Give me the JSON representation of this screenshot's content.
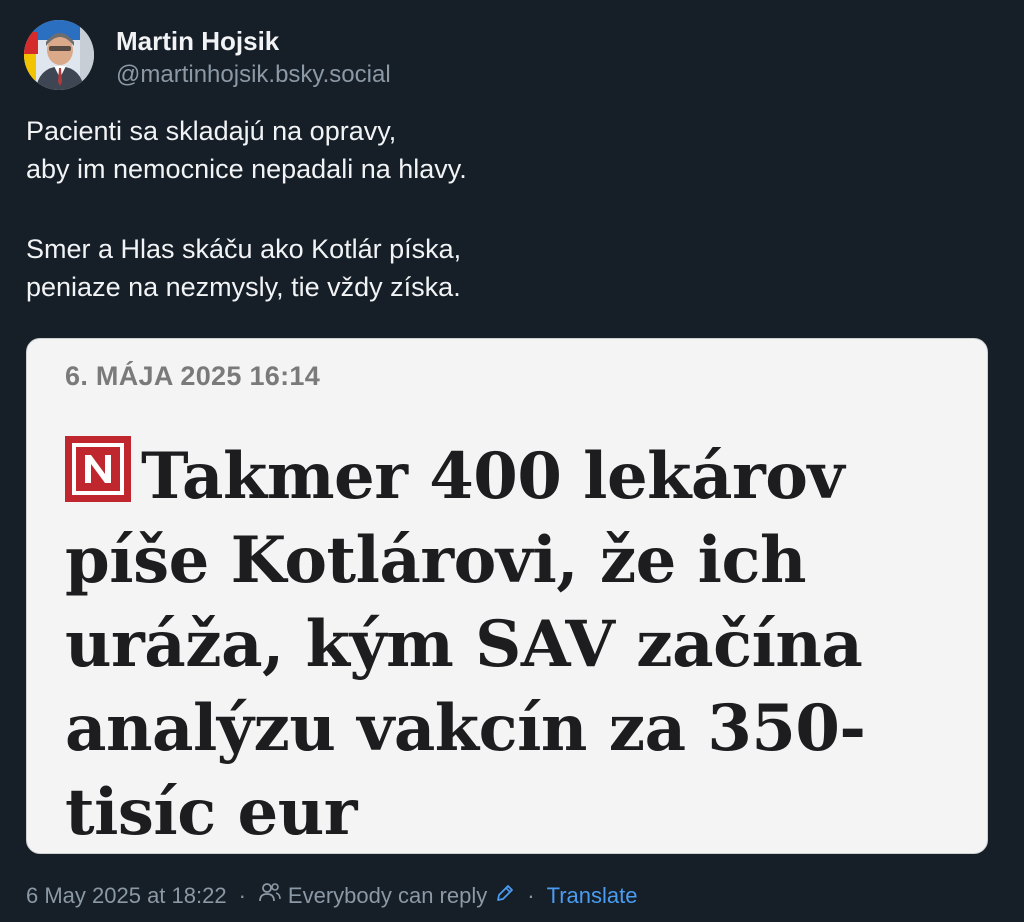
{
  "author": {
    "display_name": "Martin Hojsik",
    "handle": "@martinhojsik.bsky.social"
  },
  "post": {
    "lines": [
      "Pacienti sa skladajú na opravy,",
      "aby im nemocnice nepadali na hlavy.",
      "Smer a Hlas skáču ako Kotlár píska,",
      "peniaze na nezmysly, tie vždy získa."
    ]
  },
  "embed": {
    "date": "6. MÁJA 2025 16:14",
    "logo_letter": "N",
    "headline": "Takmer 400 lekárov píše Kotlárovi, že ich uráža, kým SAV začína analýzu vakcín za 350-tisíc eur",
    "headline_lines": [
      "Takmer 400 lekárov",
      "píše Kotlárovi, že ich",
      "uráža, kým SAV začína",
      "analýzu vakcín za 350-",
      "tisíc eur"
    ],
    "colors": {
      "logo_bg": "#c0262d",
      "card_bg": "#f4f4f4",
      "date_text": "#7a7a7a"
    }
  },
  "footer": {
    "timestamp": "6 May 2025 at 18:22",
    "reply_setting": "Everybody can reply",
    "separator": "·",
    "translate_label": "Translate"
  },
  "icons": {
    "reply_setting": "people-icon",
    "edit": "pencil-icon"
  },
  "colors": {
    "background": "#161e27",
    "text_primary": "#f1f3f5",
    "text_secondary": "#8b98a5",
    "link": "#4a9cf0"
  }
}
